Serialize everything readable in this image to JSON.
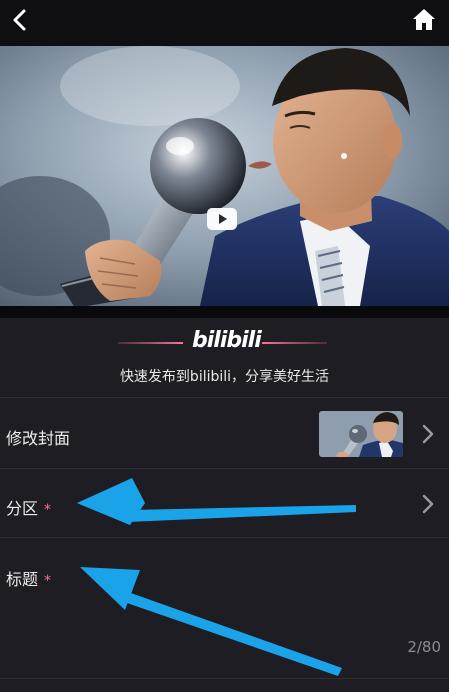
{
  "header": {
    "back_icon": "chevron-left-icon",
    "home_icon": "home-icon"
  },
  "video": {
    "play_icon": "play-icon"
  },
  "brand": {
    "logo": "bilibili",
    "slogan": "快速发布到bilibili，分享美好生活",
    "accent_color": "#fb7299"
  },
  "form": {
    "cover": {
      "label": "修改封面",
      "icon": "chevron-right-icon"
    },
    "zone": {
      "label": "分区",
      "required_mark": "*",
      "icon": "chevron-right-icon"
    },
    "title": {
      "label": "标题",
      "required_mark": "*",
      "counter": "2/80"
    }
  },
  "annotations": {
    "arrow_color": "#1aa3e8"
  }
}
